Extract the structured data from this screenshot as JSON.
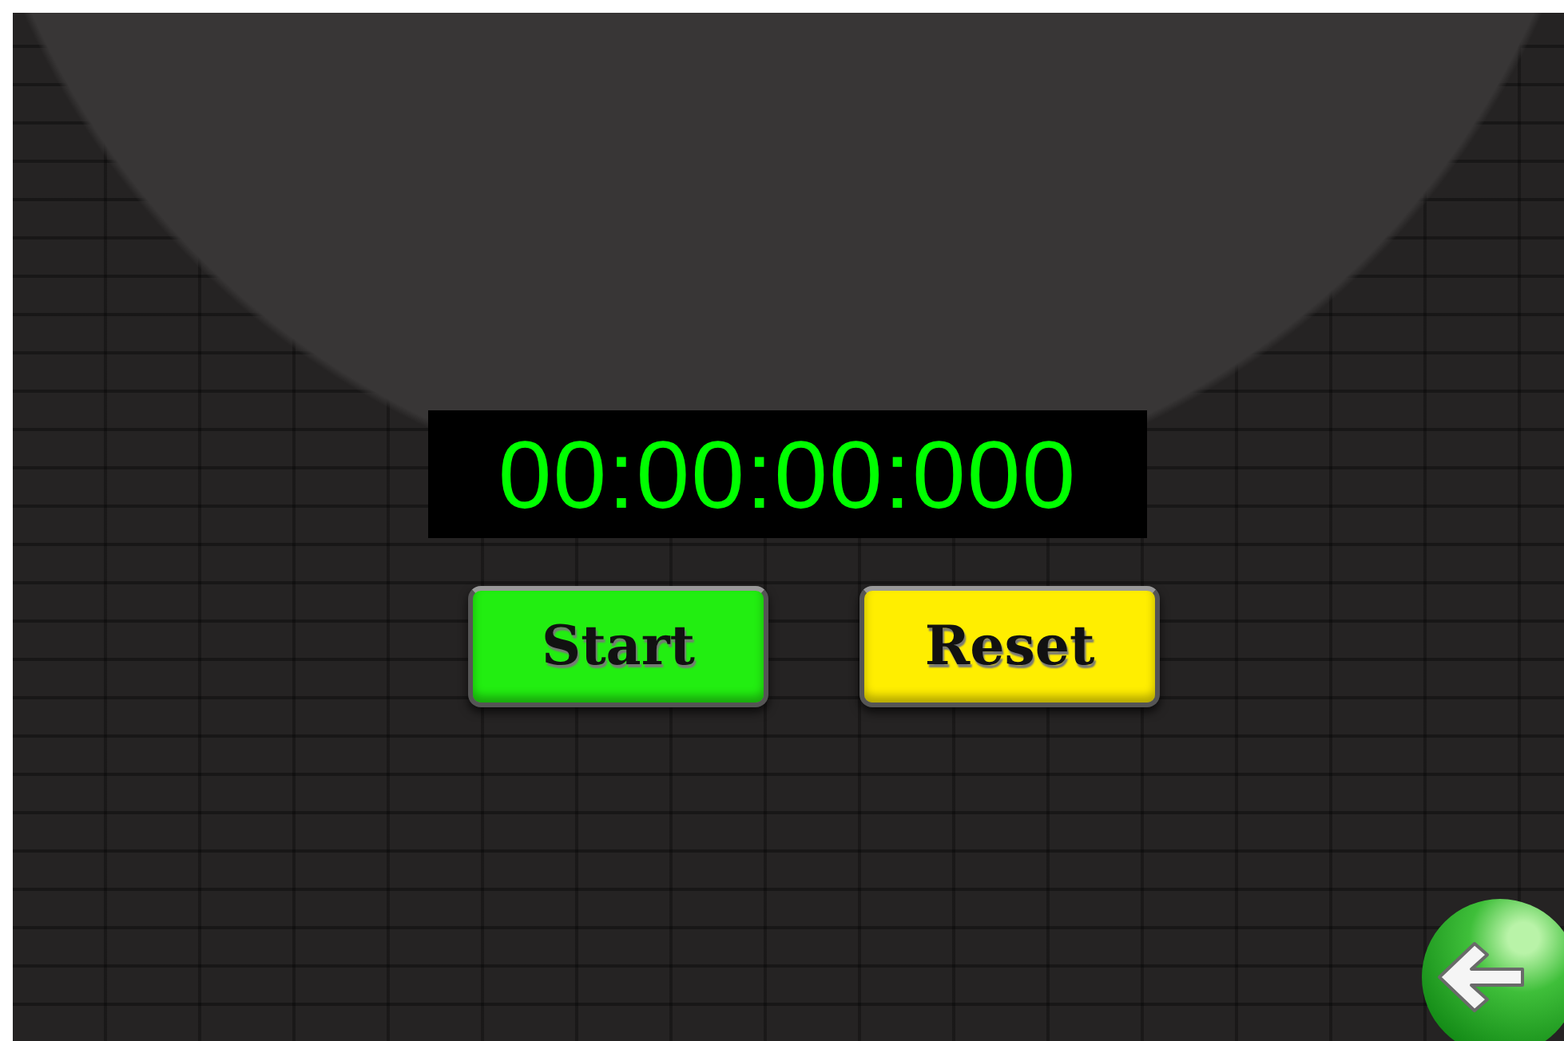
{
  "timer": {
    "display": "00:00:00:000"
  },
  "buttons": [
    {
      "label": "Start",
      "kind": "start"
    },
    {
      "label": "Reset",
      "kind": "reset"
    }
  ]
}
